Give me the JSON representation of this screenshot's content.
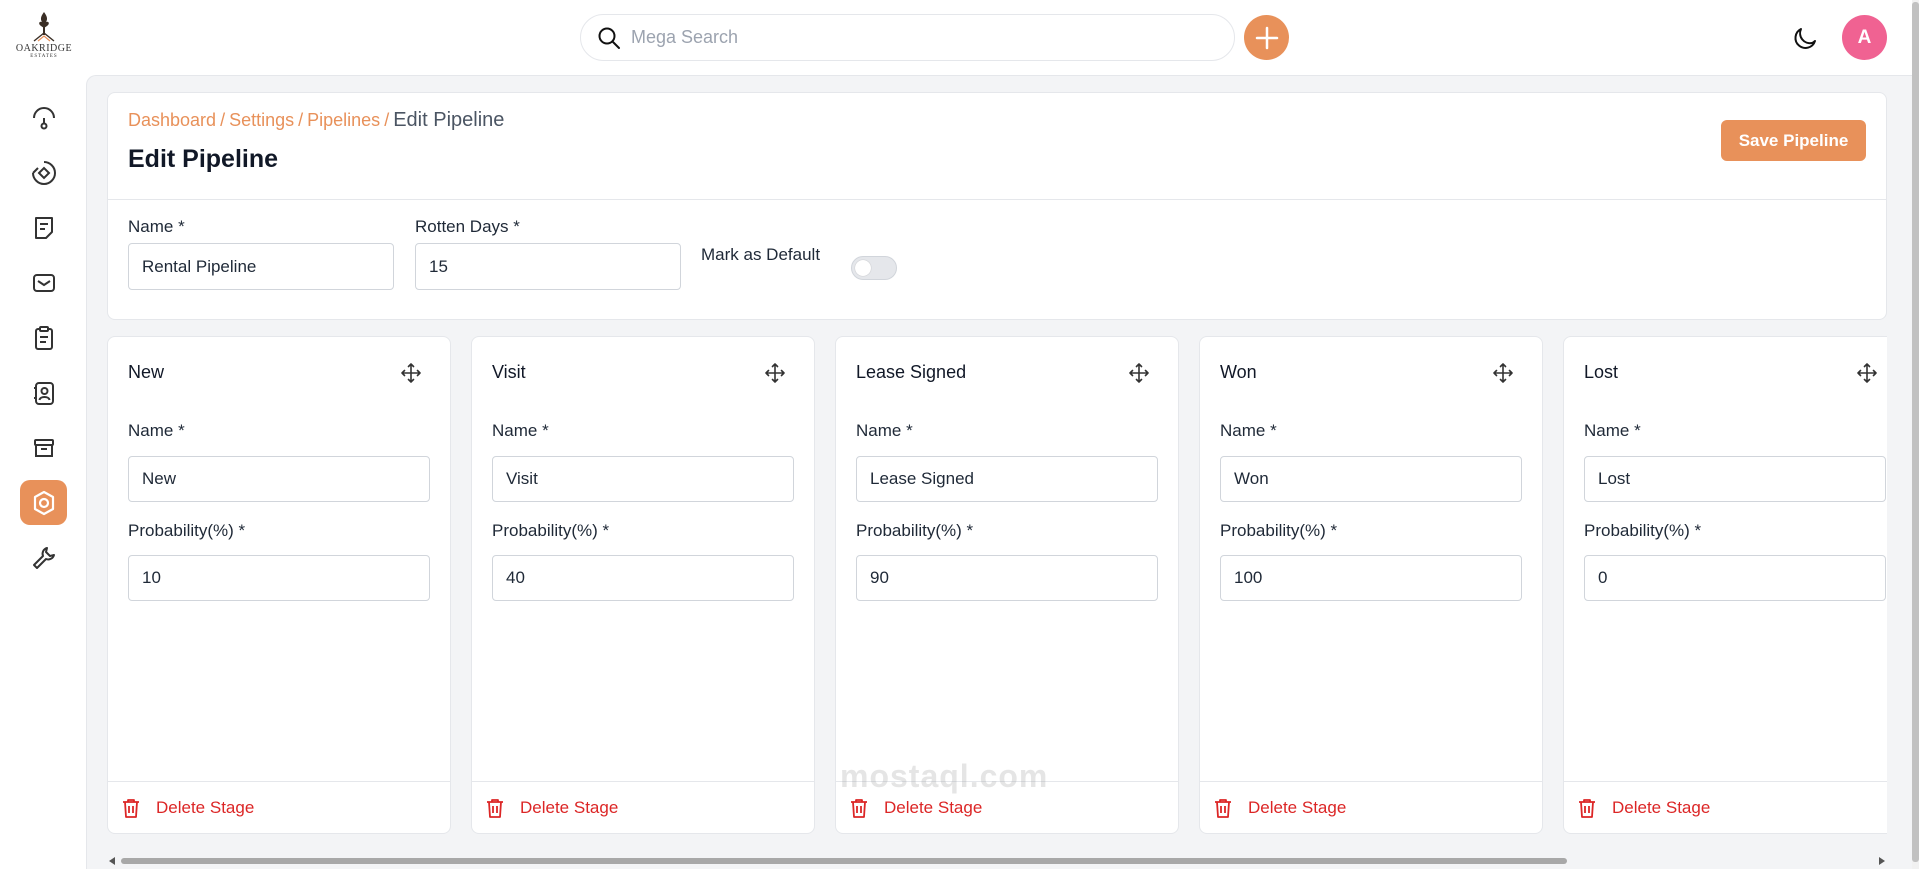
{
  "brand": {
    "name": "OAKRIDGE",
    "subtitle": "ESTATES"
  },
  "search": {
    "placeholder": "Mega Search"
  },
  "user": {
    "avatar_initial": "A"
  },
  "sidebar": {
    "items": [
      {
        "name": "dashboard",
        "icon": "gauge-icon",
        "active": false
      },
      {
        "name": "leads",
        "icon": "leads-icon",
        "active": false
      },
      {
        "name": "quotes",
        "icon": "quote-icon",
        "active": false
      },
      {
        "name": "mail",
        "icon": "mail-icon",
        "active": false
      },
      {
        "name": "activities",
        "icon": "clipboard-icon",
        "active": false
      },
      {
        "name": "contacts",
        "icon": "contact-book-icon",
        "active": false
      },
      {
        "name": "products",
        "icon": "archive-box-icon",
        "active": false
      },
      {
        "name": "settings",
        "icon": "settings-icon",
        "active": true
      },
      {
        "name": "configuration",
        "icon": "wrench-icon",
        "active": false
      }
    ]
  },
  "breadcrumb": {
    "items": [
      "Dashboard",
      "Settings",
      "Pipelines"
    ],
    "separator": "/",
    "current": "Edit Pipeline"
  },
  "page": {
    "title": "Edit Pipeline",
    "save_label": "Save Pipeline"
  },
  "form": {
    "name_label": "Name *",
    "name_value": "Rental Pipeline",
    "rotten_label": "Rotten Days *",
    "rotten_value": "15",
    "default_label": "Mark as Default",
    "default_on": false
  },
  "stage_labels": {
    "name": "Name *",
    "probability": "Probability(%) *",
    "delete": "Delete Stage"
  },
  "stages": [
    {
      "title": "New",
      "name": "New",
      "probability": "10"
    },
    {
      "title": "Visit",
      "name": "Visit",
      "probability": "40"
    },
    {
      "title": "Lease Signed",
      "name": "Lease Signed",
      "probability": "90"
    },
    {
      "title": "Won",
      "name": "Won",
      "probability": "100"
    },
    {
      "title": "Lost",
      "name": "Lost",
      "probability": "0"
    }
  ],
  "watermark": "mostaql.com",
  "colors": {
    "accent": "#e8915a",
    "danger": "#dc2626",
    "avatar": "#f06292"
  }
}
